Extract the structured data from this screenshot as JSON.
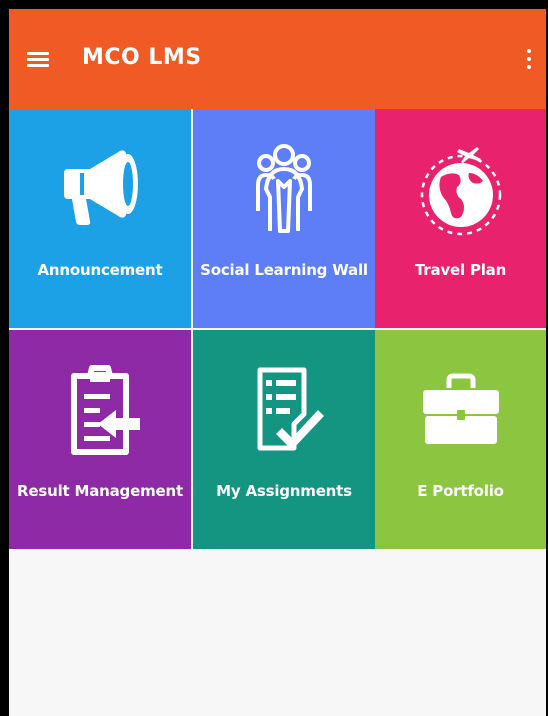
{
  "app": {
    "title": "MCO LMS",
    "colors": {
      "appbar": "#f05a24",
      "background": "#f7f7f7"
    }
  },
  "tiles": [
    {
      "label": "Announcement",
      "icon": "megaphone-icon",
      "color": "#1ca1e7"
    },
    {
      "label": "Social Learning Wall",
      "icon": "people-group-icon",
      "color": "#5d7ef6"
    },
    {
      "label": "Travel Plan",
      "icon": "globe-plane-icon",
      "color": "#e8226c"
    },
    {
      "label": "Result Management",
      "icon": "clipboard-arrow-icon",
      "color": "#8f2aa7"
    },
    {
      "label": "My Assignments",
      "icon": "checklist-icon",
      "color": "#139582"
    },
    {
      "label": "E Portfolio",
      "icon": "briefcase-icon",
      "color": "#8cc540"
    }
  ]
}
